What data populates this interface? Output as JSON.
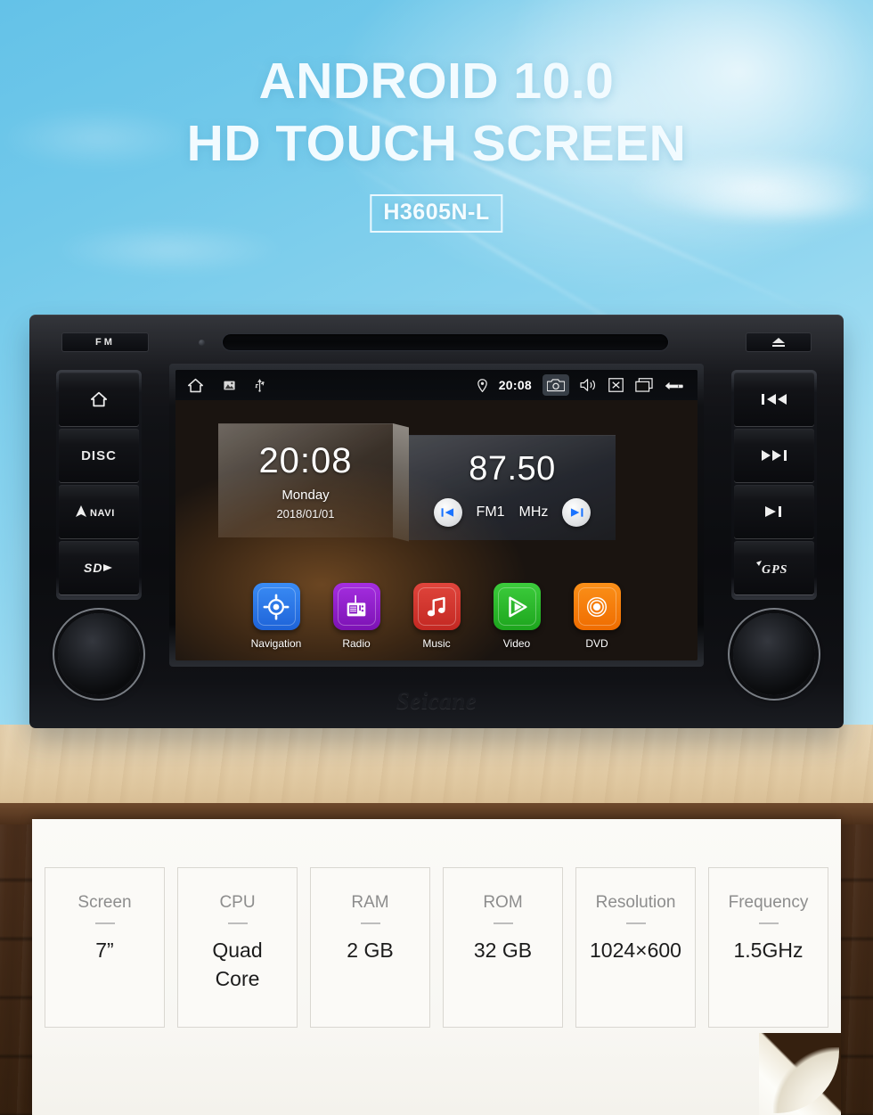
{
  "hero": {
    "line1": "ANDROID 10.0",
    "line2": "HD TOUCH SCREEN",
    "model_badge": "H3605N-L"
  },
  "head_unit": {
    "brand": "Seicane",
    "fm_button": "FM",
    "eject_icon": "eject-icon",
    "disc_slot": "disc-slot",
    "left_buttons": [
      {
        "label": "",
        "icon": "home-icon",
        "name": "home"
      },
      {
        "label": "DISC",
        "icon": "",
        "name": "disc"
      },
      {
        "label": "NAVI",
        "icon": "navi-icon",
        "name": "navi"
      },
      {
        "label": "",
        "icon": "sd-icon",
        "name": "sd"
      }
    ],
    "right_buttons": [
      {
        "label": "",
        "icon": "skip-previous-icon",
        "name": "previous-track"
      },
      {
        "label": "",
        "icon": "skip-next-icon",
        "name": "next-track"
      },
      {
        "label": "",
        "icon": "play-pause-icon",
        "name": "play-pause"
      },
      {
        "label": "GPS",
        "icon": "gps-icon",
        "name": "gps"
      }
    ],
    "left_knob": "volume-knob",
    "right_knob": "tune-knob"
  },
  "screen": {
    "status_bar": {
      "left_icons": [
        "home-icon",
        "image-icon",
        "usb-icon"
      ],
      "location_icon": "location-pin-icon",
      "time": "20:08",
      "right_icons": [
        "camera-icon",
        "volume-icon",
        "close-icon",
        "recent-apps-icon",
        "back-icon"
      ]
    },
    "clock_widget": {
      "time": "20:08",
      "weekday": "Monday",
      "date": "2018/01/01"
    },
    "radio_widget": {
      "frequency": "87.50",
      "band": "FM1",
      "unit": "MHz",
      "prev_icon": "skip-previous-icon",
      "next_icon": "skip-next-icon"
    },
    "apps": [
      {
        "label": "Navigation",
        "color": "#2979e8",
        "icon": "navigation-target-icon"
      },
      {
        "label": "Radio",
        "color": "#9121c8",
        "icon": "radio-icon"
      },
      {
        "label": "Music",
        "color": "#d6342e",
        "icon": "music-note-icon"
      },
      {
        "label": "Video",
        "color": "#2eb830",
        "icon": "video-play-icon"
      },
      {
        "label": "DVD",
        "color": "#f57f17",
        "icon": "dvd-disc-icon"
      }
    ]
  },
  "specs": [
    {
      "label": "Screen",
      "value": "7”"
    },
    {
      "label": "CPU",
      "value": "Quad\nCore"
    },
    {
      "label": "RAM",
      "value": "2 GB"
    },
    {
      "label": "ROM",
      "value": "32 GB"
    },
    {
      "label": "Resolution",
      "value": "1024×600"
    },
    {
      "label": "Frequency",
      "value": "1.5GHz"
    }
  ]
}
